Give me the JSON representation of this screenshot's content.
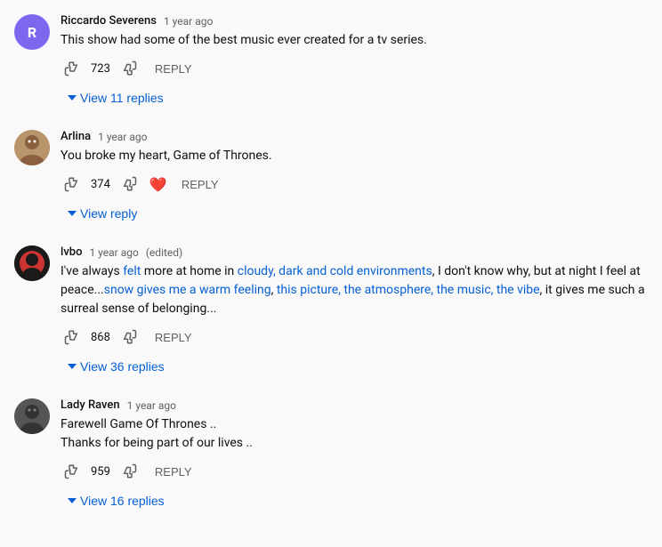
{
  "comments": [
    {
      "id": "riccardo",
      "author": "Riccardo Severens",
      "timestamp": "1 year ago",
      "edited": false,
      "text": "This show had some of the best music ever created for a tv series.",
      "likes": "723",
      "hasHeart": false,
      "viewReplies": "View 11 replies",
      "avatarType": "initial",
      "avatarInitial": "R",
      "avatarColor": "#7b68ee"
    },
    {
      "id": "arlina",
      "author": "Arlina",
      "timestamp": "1 year ago",
      "edited": false,
      "text": "You broke my heart, Game of Thrones.",
      "likes": "374",
      "hasHeart": true,
      "viewReplies": "View reply",
      "avatarType": "arlina"
    },
    {
      "id": "ivbo",
      "author": "lvbo",
      "timestamp": "1 year ago",
      "edited": true,
      "textParts": [
        {
          "text": "I've always "
        },
        {
          "text": "felt",
          "highlight": true
        },
        {
          "text": " more at home in "
        },
        {
          "text": "cloudy, dark and cold environments",
          "highlight": true
        },
        {
          "text": ", I don't know why, but at night I feel at peace..."
        },
        {
          "text": "snow gives me a warm feeling",
          "highlight": true
        },
        {
          "text": ", "
        },
        {
          "text": "this picture, the atmosphere, the music, the vibe",
          "highlight": true
        },
        {
          "text": ", it gives me such a surreal sense of belonging..."
        }
      ],
      "likes": "868",
      "hasHeart": false,
      "viewReplies": "View 36 replies",
      "avatarType": "ivbo"
    },
    {
      "id": "ladyraven",
      "author": "Lady Raven",
      "timestamp": "1 year ago",
      "edited": false,
      "textLines": [
        "Farewell Game Of Thrones ..",
        "Thanks for being part of our lives .."
      ],
      "likes": "959",
      "hasHeart": false,
      "viewReplies": "View 16 replies",
      "avatarType": "ladyraven"
    }
  ],
  "labels": {
    "reply": "REPLY",
    "edited": "(edited)"
  }
}
